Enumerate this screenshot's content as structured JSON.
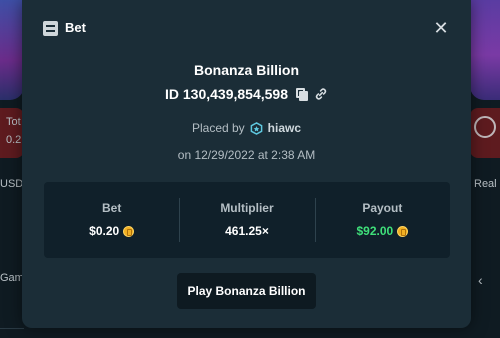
{
  "background": {
    "left_texts": [
      "Tot",
      "0.2",
      "USD",
      "Gam"
    ],
    "right_texts": [
      "Real"
    ]
  },
  "modal": {
    "header": {
      "icon": "bet-slip-icon",
      "title": "Bet",
      "close_icon": "close-icon"
    },
    "game_title": "Bonanza Billion",
    "bet_id": "ID 130,439,854,598",
    "placed_by_label": "Placed by",
    "username": "hiawc",
    "date": "on 12/29/2022 at 2:38 AM",
    "stats": {
      "bet_label": "Bet",
      "bet_value": "$0.20",
      "multiplier_label": "Multiplier",
      "multiplier_value": "461.25×",
      "payout_label": "Payout",
      "payout_value": "$92.00"
    },
    "play_button": "Play Bonanza Billion"
  },
  "colors": {
    "modal_bg": "#1b2d37",
    "panel_bg": "#10202a",
    "payout_green": "#3fe07a",
    "coin_gold": "#f2b022"
  }
}
